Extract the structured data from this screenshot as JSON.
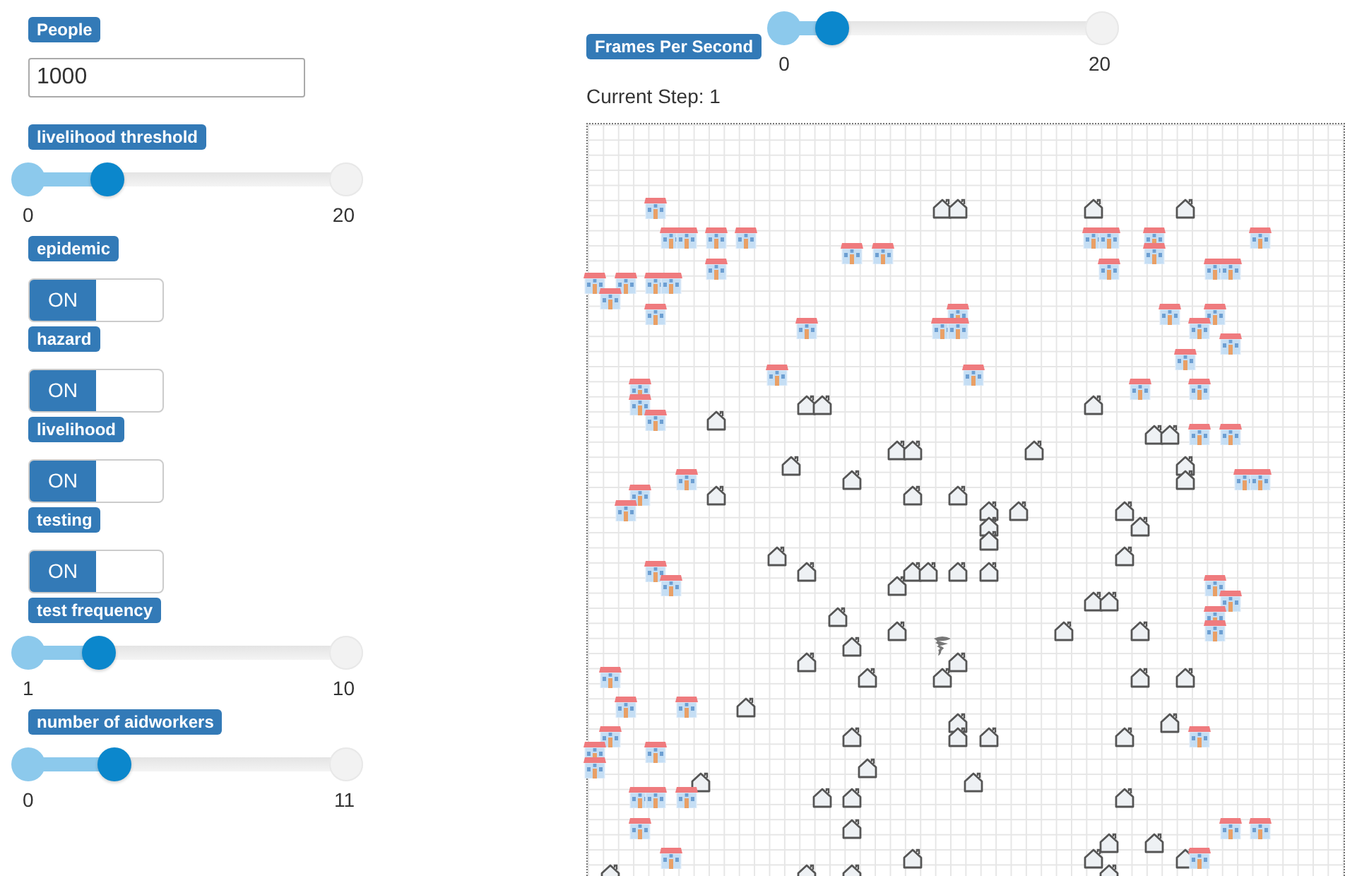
{
  "controls": [
    {
      "kind": "number",
      "label": "People",
      "value": "1000"
    },
    {
      "kind": "slider",
      "label": "livelihood threshold",
      "level": 0.25,
      "min": "0",
      "max": "20"
    },
    {
      "kind": "toggle",
      "label": "epidemic",
      "on": true,
      "state_text": "ON"
    },
    {
      "kind": "toggle",
      "label": "hazard",
      "on": true,
      "state_text": "ON"
    },
    {
      "kind": "toggle",
      "label": "livelihood",
      "on": true,
      "state_text": "ON"
    },
    {
      "kind": "toggle",
      "label": "testing",
      "on": true,
      "state_text": "ON"
    },
    {
      "kind": "slider",
      "label": "test frequency",
      "level": 0.222,
      "min": "1",
      "max": "10"
    },
    {
      "kind": "slider",
      "label": "number of aidworkers",
      "level": 0.273,
      "min": "0",
      "max": "11"
    }
  ],
  "fps": {
    "label": "Frames Per Second",
    "level": 0.15,
    "min": "0",
    "max": "20"
  },
  "current_step": "Current Step: 1"
}
